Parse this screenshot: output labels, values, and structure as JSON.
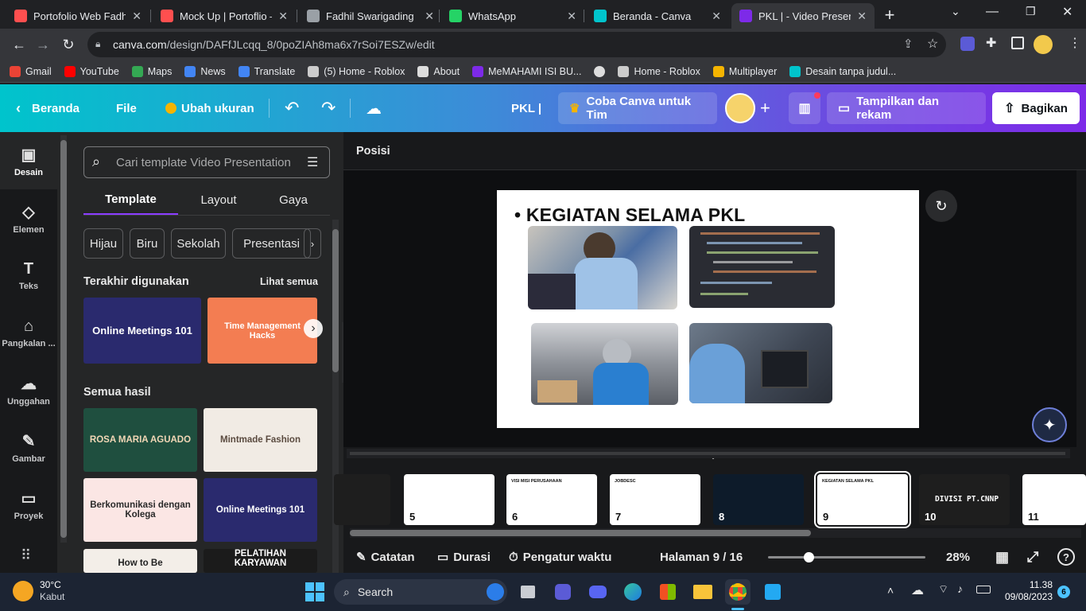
{
  "browser": {
    "tabs": [
      {
        "title": "Portofolio Web Fadhil",
        "icon": "canva-favicon-icon",
        "color": "#ff4f4f",
        "active": false
      },
      {
        "title": "Mock Up | Portoflio – ",
        "icon": "canva-favicon-icon",
        "color": "#ff4f4f",
        "active": false
      },
      {
        "title": "Fadhil Swarigading",
        "icon": "globe-icon",
        "color": "#9aa0a6",
        "active": false
      },
      {
        "title": "WhatsApp",
        "icon": "whatsapp-icon",
        "color": "#25d366",
        "active": false
      },
      {
        "title": "Beranda - Canva",
        "icon": "canva-favicon-icon",
        "color": "#00c4cc",
        "active": false
      },
      {
        "title": "PKL | - Video Presenta",
        "icon": "canva-favicon-icon",
        "color": "#7d2ae8",
        "active": true
      }
    ],
    "url_domain": "canva.com",
    "url_path": "/design/DAFfJLcqq_8/0poZIAh8ma6x7rSoi7ESZw/edit",
    "bookmarks": [
      {
        "label": "Gmail",
        "color": "#ea4335"
      },
      {
        "label": "YouTube",
        "color": "#ff0000"
      },
      {
        "label": "Maps",
        "color": "#34a853"
      },
      {
        "label": "News",
        "color": "#4285f4"
      },
      {
        "label": "Translate",
        "color": "#4285f4"
      },
      {
        "label": "(5) Home - Roblox",
        "color": "#cccccc"
      },
      {
        "label": "About",
        "color": "#dddddd"
      },
      {
        "label": "MeMAHAMI ISI BU...",
        "color": "#7d2ae8"
      },
      {
        "label": "",
        "color": "#dddddd"
      },
      {
        "label": "Home - Roblox",
        "color": "#cccccc"
      },
      {
        "label": "Multiplayer",
        "color": "#f5b400"
      },
      {
        "label": "Desain tanpa judul...",
        "color": "#00c4cc"
      }
    ]
  },
  "canva": {
    "home_label": "Beranda",
    "file_label": "File",
    "resize_label": "Ubah ukuran",
    "design_title": "PKL |",
    "team_label": "Coba Canva untuk Tim",
    "present_label": "Tampilkan dan rekam",
    "share_label": "Bagikan"
  },
  "rail": [
    {
      "label": "Desain",
      "icon": "layout-icon",
      "glyph": "▣"
    },
    {
      "label": "Elemen",
      "icon": "shapes-icon",
      "glyph": "◇"
    },
    {
      "label": "Teks",
      "icon": "text-icon",
      "glyph": "T"
    },
    {
      "label": "Pangkalan ...",
      "icon": "brand-kit-icon",
      "glyph": "⌂"
    },
    {
      "label": "Unggahan",
      "icon": "upload-cloud-icon",
      "glyph": "☁"
    },
    {
      "label": "Gambar",
      "icon": "draw-icon",
      "glyph": "✎"
    },
    {
      "label": "Proyek",
      "icon": "folder-icon",
      "glyph": "▭"
    }
  ],
  "panel": {
    "search_placeholder": "Cari template Video Presentation",
    "tabs": [
      "Template",
      "Layout",
      "Gaya"
    ],
    "chips": [
      "Hijau",
      "Biru",
      "Sekolah",
      "Presentasi"
    ],
    "recent_title": "Terakhir digunakan",
    "see_all": "Lihat semua",
    "recent": [
      {
        "title": "Online Meetings 101",
        "bg": "#2a2a6e",
        "fg": "#ffffff"
      },
      {
        "title": "Time Management Hacks",
        "bg": "#f37d52",
        "fg": "#ffffff"
      }
    ],
    "all_title": "Semua hasil",
    "results": [
      {
        "title": "ROSA MARIA AGUADO",
        "bg": "#1f4f3f",
        "fg": "#f2d7b6"
      },
      {
        "title": "Mintmade Fashion",
        "bg": "#f1ebe4",
        "fg": "#5a4a3f"
      },
      {
        "title": "Berkomunikasi dengan Kolega",
        "bg": "#fbe6e4",
        "fg": "#2a2a2a"
      },
      {
        "title": "Online Meetings 101",
        "bg": "#2a2a6e",
        "fg": "#ffffff"
      },
      {
        "title": "How to Be",
        "bg": "#f3eee8",
        "fg": "#222222"
      },
      {
        "title": "PELATIHAN KARYAWAN",
        "bg": "#1b1b1b",
        "fg": "#ffffff"
      }
    ]
  },
  "editor": {
    "position_label": "Posisi",
    "slide_heading": "KEGIATAN SELAMA PKL"
  },
  "pages": [
    {
      "num": "",
      "caption": "",
      "bg": "#1e1e1e"
    },
    {
      "num": "5",
      "caption": "",
      "bg": "#ffffff"
    },
    {
      "num": "6",
      "caption": "VISI MISI PERUSAHAAN",
      "bg": "#ffffff"
    },
    {
      "num": "7",
      "caption": "JOBDESC",
      "bg": "#ffffff"
    },
    {
      "num": "8",
      "caption": "",
      "bg": "#0d1b2a"
    },
    {
      "num": "9",
      "caption": "KEGIATAN SELAMA PKL",
      "bg": "#ffffff"
    },
    {
      "num": "10",
      "caption": "DIVISI PT.CNNP",
      "bg": "#1e1e1e"
    },
    {
      "num": "11",
      "caption": "",
      "bg": "#ffffff"
    }
  ],
  "footer": {
    "notes_label": "Catatan",
    "duration_label": "Durasi",
    "timer_label": "Pengatur waktu",
    "page_label": "Halaman 9 / 16",
    "zoom_label": "28%"
  },
  "taskbar": {
    "temp": "30°C",
    "weather": "Kabut",
    "search_label": "Search",
    "time": "11.38",
    "date": "09/08/2023",
    "notif_count": "6"
  }
}
